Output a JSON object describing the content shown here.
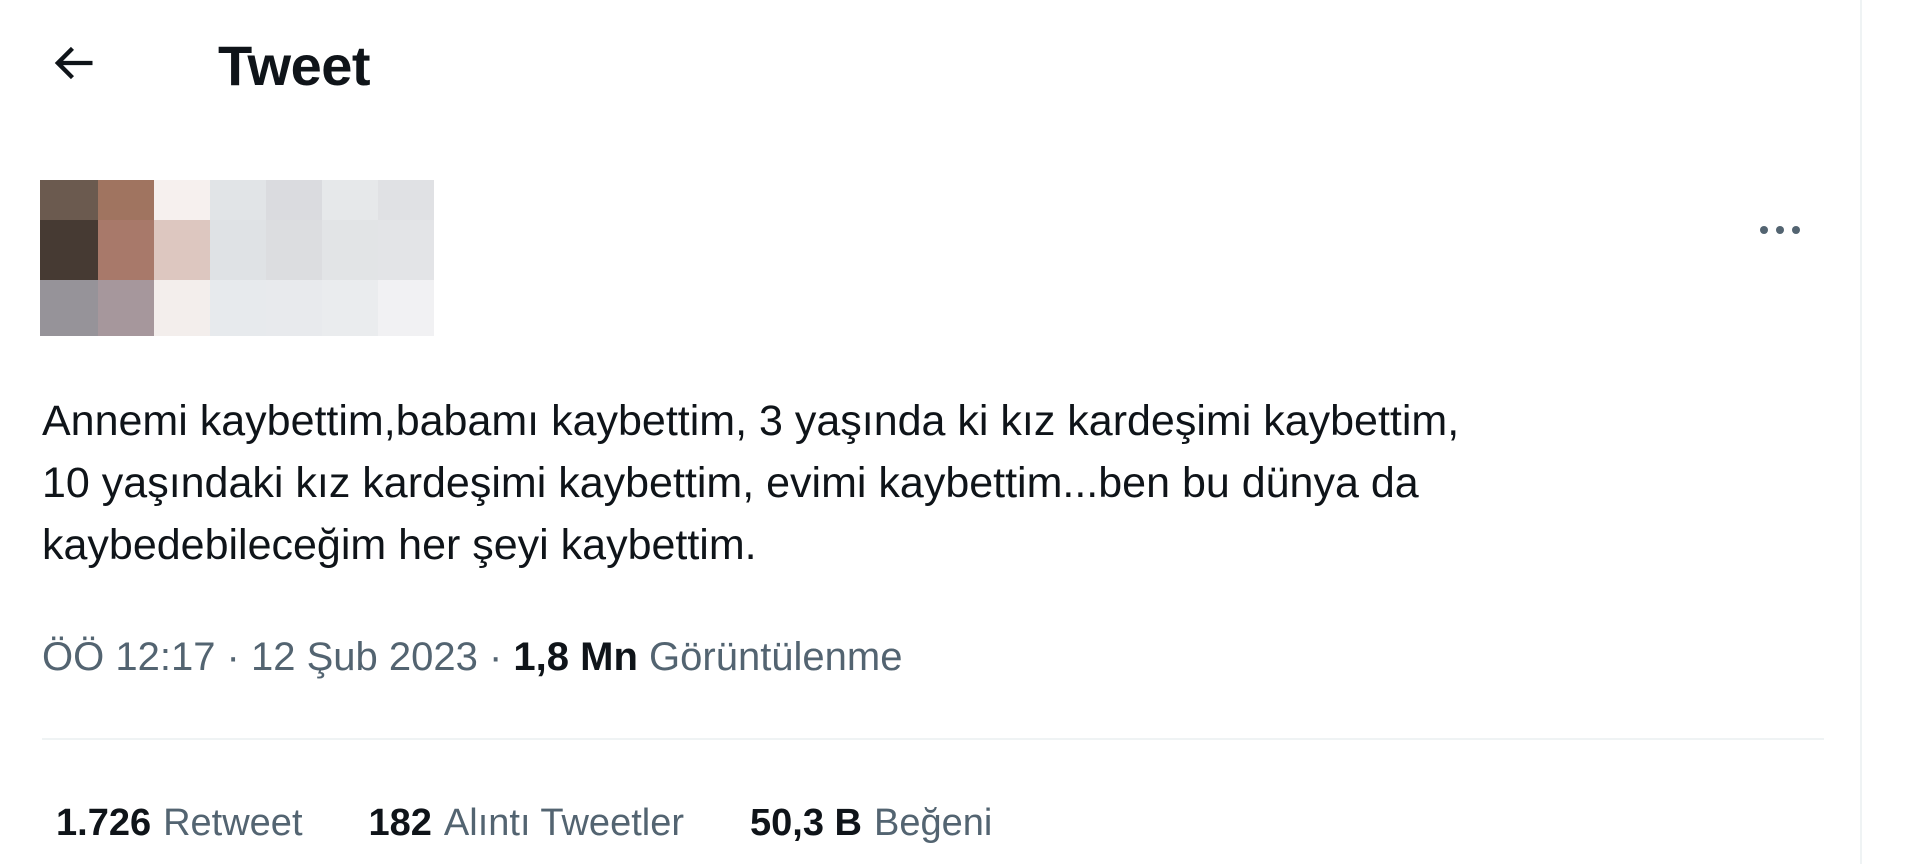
{
  "header": {
    "title": "Tweet",
    "back_icon": "arrow-left-icon"
  },
  "author": {
    "avatar": "pixelated-avatar",
    "name_obscured": true,
    "more_icon": "more-horizontal-icon"
  },
  "tweet": {
    "text": "Annemi kaybettim,babamı kaybettim, 3 yaşında ki kız kardeşimi kaybettim,\n10 yaşındaki kız kardeşimi kaybettim, evimi kaybettim...ben bu dünya da\nkaybedebileceğim her şeyi kaybettim."
  },
  "meta": {
    "time": "ÖÖ 12:17",
    "separator": " · ",
    "date": "12 Şub 2023",
    "views_count": "1,8 Mn",
    "views_label": "Görüntülenme"
  },
  "stats": {
    "retweets": {
      "count": "1.726",
      "label": "Retweet"
    },
    "quotes": {
      "count": "182",
      "label": "Alıntı Tweetler"
    },
    "likes": {
      "count": "50,3 B",
      "label": "Beğeni"
    }
  },
  "colors": {
    "text_primary": "#0f1419",
    "text_secondary": "#536471",
    "divider": "#eff3f4",
    "background": "#ffffff"
  }
}
